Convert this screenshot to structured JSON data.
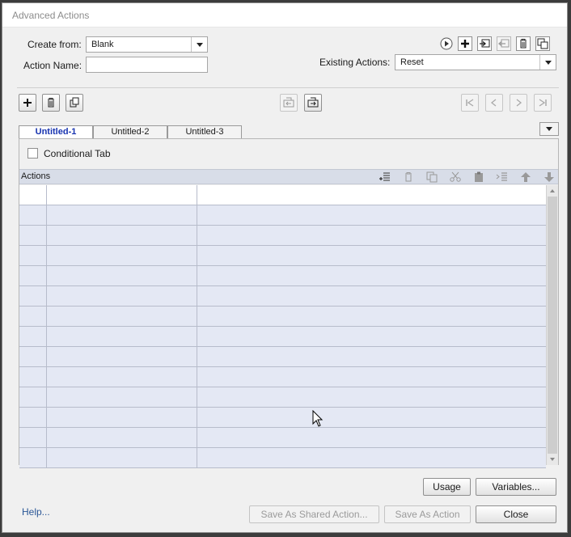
{
  "window": {
    "title": "Advanced Actions"
  },
  "form": {
    "create_from_label": "Create from:",
    "create_from_value": "Blank",
    "action_name_label": "Action Name:",
    "action_name_value": "",
    "existing_actions_label": "Existing Actions:",
    "existing_actions_value": "Reset"
  },
  "tabs": [
    {
      "label": "Untitled-1",
      "active": true
    },
    {
      "label": "Untitled-2",
      "active": false
    },
    {
      "label": "Untitled-3",
      "active": false
    }
  ],
  "conditional": {
    "label": "Conditional Tab",
    "checked": false
  },
  "actions_table": {
    "header": "Actions",
    "row_count": 14
  },
  "buttons": {
    "usage": "Usage",
    "variables": "Variables...",
    "help": "Help...",
    "save_shared": "Save As Shared Action...",
    "save_action": "Save As Action",
    "close": "Close"
  },
  "icons": {
    "top_toolbar": [
      "play-icon",
      "add-action-icon",
      "import-icon",
      "export-icon",
      "delete-action-icon",
      "duplicate-action-icon"
    ],
    "tab_toolbar": [
      "add-tab-icon",
      "delete-tab-icon",
      "duplicate-tab-icon",
      "import-block-icon",
      "export-block-icon",
      "first-tab-icon",
      "previous-tab-icon",
      "next-tab-icon",
      "last-tab-icon"
    ],
    "actions_toolbar": [
      "insert-row-icon",
      "delete-row-icon",
      "copy-row-icon",
      "cut-row-icon",
      "paste-row-icon",
      "indent-row-icon",
      "move-up-icon",
      "move-down-icon"
    ]
  },
  "colors": {
    "row_fill": "#e4e8f4",
    "active_tab": "#1733b0",
    "header_fill": "#d8dde8"
  }
}
